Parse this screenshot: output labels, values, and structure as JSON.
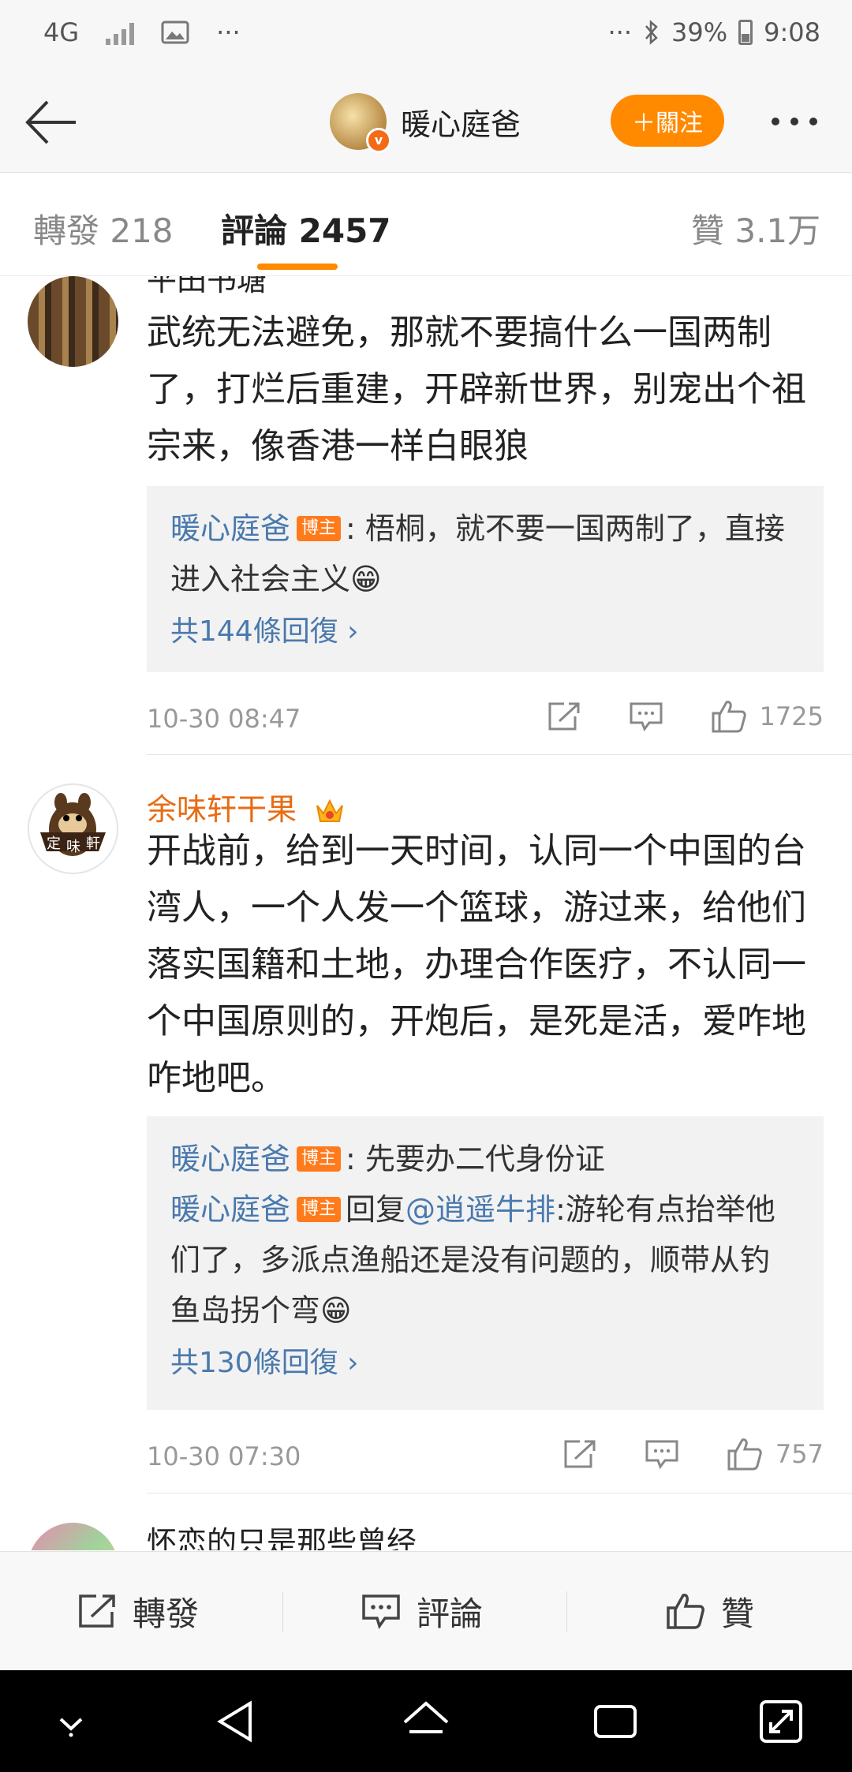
{
  "status_bar": {
    "network": "4G",
    "more_left": "···",
    "more_right": "···",
    "battery": "39%",
    "time": "9:08"
  },
  "header": {
    "title": "暖心庭爸",
    "follow_label": "＋關注"
  },
  "tabs": {
    "repost": "轉發 218",
    "comments": "評論 2457",
    "likes": "贊 3.1万"
  },
  "comments": [
    {
      "name": "平田书塘",
      "text_lines": [
        "武统无法避免，那就不要搞什么一国两制",
        "了，打烂后重建，开辟新世界，别宠出个祖",
        "宗来，像香港一样白眼狼"
      ],
      "replies": [
        {
          "name": "暖心庭爸",
          "badge": "博主",
          "lines": [
            ": 梧桐，就不要一国两制了，直接",
            "进入社会主义😁"
          ]
        }
      ],
      "more_replies": "共144條回復 ›",
      "date": "10-30 08:47",
      "likes": "1725"
    },
    {
      "name": "余味轩干果",
      "text_lines": [
        "开战前，给到一天时间，认同一个中国的台",
        "湾人，一个人发一个篮球，游过来，给他们",
        "落实国籍和土地，办理合作医疗，不认同一",
        "个中国原则的，开炮后，是死是活，爱咋地",
        "咋地吧。"
      ],
      "replies": [
        {
          "name": "暖心庭爸",
          "badge": "博主",
          "lines": [
            ": 先要办二代身份证"
          ]
        },
        {
          "name": "暖心庭爸",
          "badge": "博主",
          "reply_prefix": "回复",
          "mention": "@逍遥牛排",
          "lines": [
            ":游轮有点抬举他",
            "们了，多派点渔船还是没有问题的，顺带从钓",
            "鱼岛拐个弯😁"
          ]
        }
      ],
      "more_replies": "共130條回復 ›",
      "date": "10-30 07:30",
      "likes": "757"
    },
    {
      "name": "怀恋的只是那些曾经"
    }
  ],
  "bottom_bar": {
    "repost": "轉發",
    "comment": "評論",
    "like": "贊"
  },
  "colors": {
    "accent": "#ff8a00",
    "link": "#4a79ad",
    "vip_name": "#e86b12"
  }
}
